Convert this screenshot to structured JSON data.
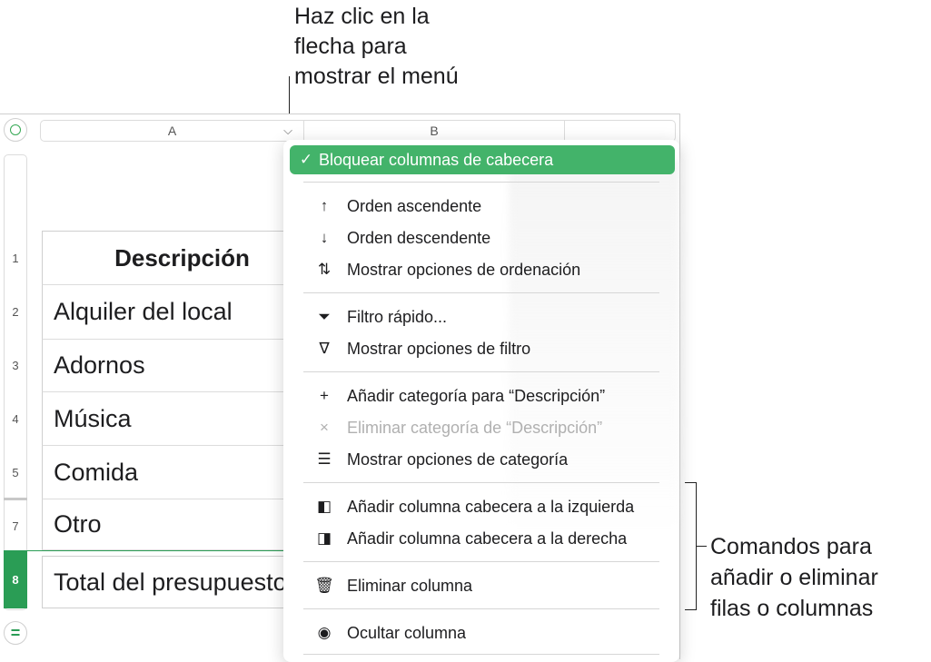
{
  "callouts": {
    "top": "Haz clic en la\nflecha para\nmostrar el menú",
    "right": "Comandos para\nañadir o eliminar\nfilas o columnas"
  },
  "sheet": {
    "columns": [
      "A",
      "B"
    ],
    "rows": [
      {
        "num": "1",
        "text": "Descripción"
      },
      {
        "num": "2",
        "text": "Alquiler del local"
      },
      {
        "num": "3",
        "text": "Adornos"
      },
      {
        "num": "4",
        "text": "Música"
      },
      {
        "num": "5",
        "text": "Comida"
      },
      {
        "num": "7",
        "text": "Otro"
      },
      {
        "num": "8",
        "text": "Total del presupuesto"
      }
    ]
  },
  "menu": {
    "items": [
      {
        "icon": "✓",
        "label": "Bloquear columnas de cabecera"
      },
      {
        "icon": "↑",
        "label": "Orden ascendente"
      },
      {
        "icon": "↓",
        "label": "Orden descendente"
      },
      {
        "icon": "⇅",
        "label": "Mostrar opciones de ordenación"
      },
      {
        "icon": "⏷",
        "label": "Filtro rápido..."
      },
      {
        "icon": "∇",
        "label": "Mostrar opciones de filtro"
      },
      {
        "icon": "+",
        "label": "Añadir categoría para “Descripción”"
      },
      {
        "icon": "×",
        "label": "Eliminar categoría de “Descripción”"
      },
      {
        "icon": "☰",
        "label": "Mostrar opciones de categoría"
      },
      {
        "icon": "◧",
        "label": "Añadir columna cabecera a la izquierda"
      },
      {
        "icon": "◨",
        "label": "Añadir columna cabecera a la derecha"
      },
      {
        "icon": "🗑",
        "label": "Eliminar columna"
      },
      {
        "icon": "◉",
        "label": "Ocultar columna"
      }
    ]
  },
  "colors": {
    "accent": "#43b36a",
    "selected_row": "#2a9d55"
  }
}
